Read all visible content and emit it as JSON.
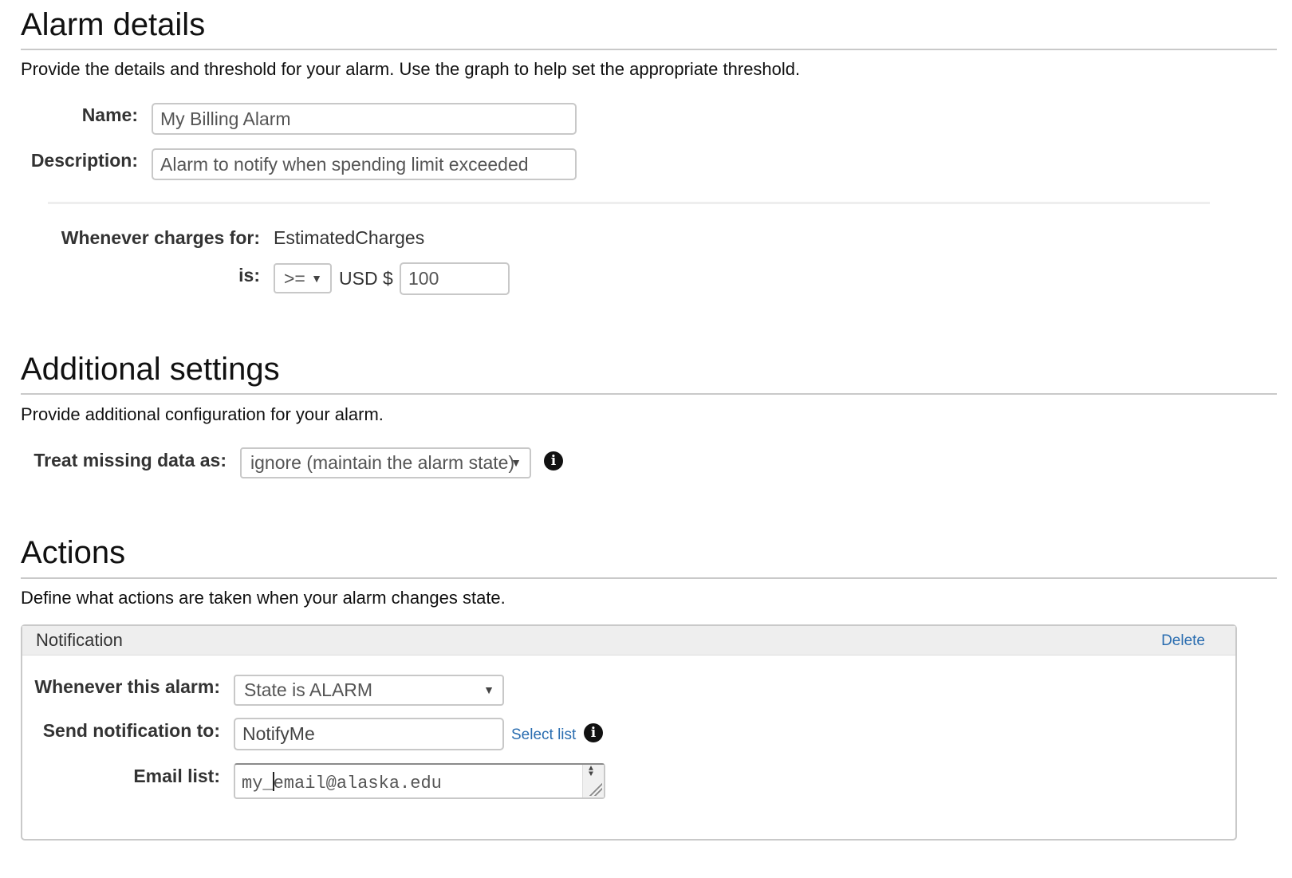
{
  "alarm_details": {
    "title": "Alarm details",
    "description": "Provide the details and threshold for your alarm. Use the graph to help set the appropriate threshold.",
    "name_label": "Name:",
    "name_value": "My Billing Alarm",
    "description_label": "Description:",
    "description_value": "Alarm to notify when spending limit exceeded",
    "charges_label": "Whenever charges for:",
    "charges_value": "EstimatedCharges",
    "is_label": "is:",
    "operator_value": ">=",
    "currency_label": "USD $",
    "threshold_value": "100"
  },
  "additional_settings": {
    "title": "Additional settings",
    "description": "Provide additional configuration for your alarm.",
    "missing_data_label": "Treat missing data as:",
    "missing_data_value": "ignore (maintain the alarm state)"
  },
  "actions": {
    "title": "Actions",
    "description": "Define what actions are taken when your alarm changes state.",
    "notification": {
      "header": "Notification",
      "delete_label": "Delete",
      "state_label": "Whenever this alarm:",
      "state_value": "State is ALARM",
      "send_to_label": "Send notification to:",
      "send_to_value": "NotifyMe",
      "select_list_label": "Select list",
      "email_label": "Email list:",
      "email_value_before_cursor": "my_",
      "email_value_after_cursor": "email@alaska.edu"
    }
  },
  "icons": {
    "info": "info-icon",
    "dropdown": "chevron-down-icon"
  }
}
